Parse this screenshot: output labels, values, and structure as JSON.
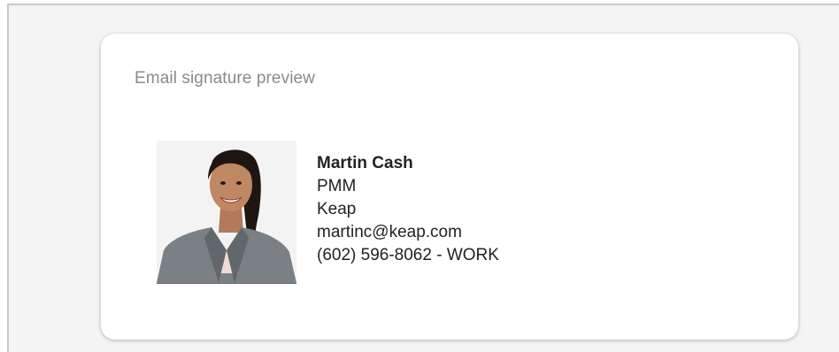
{
  "card": {
    "title": "Email signature preview"
  },
  "signature": {
    "name": "Martin Cash",
    "job_title": "PMM",
    "company": "Keap",
    "email": "martinc@keap.com",
    "phone": "(602) 596-8062 - WORK",
    "photo_icon": "person-photo"
  },
  "colors": {
    "title_text": "#8a8a8a",
    "body_text": "#222222",
    "frame_border": "#c9c9c9"
  }
}
